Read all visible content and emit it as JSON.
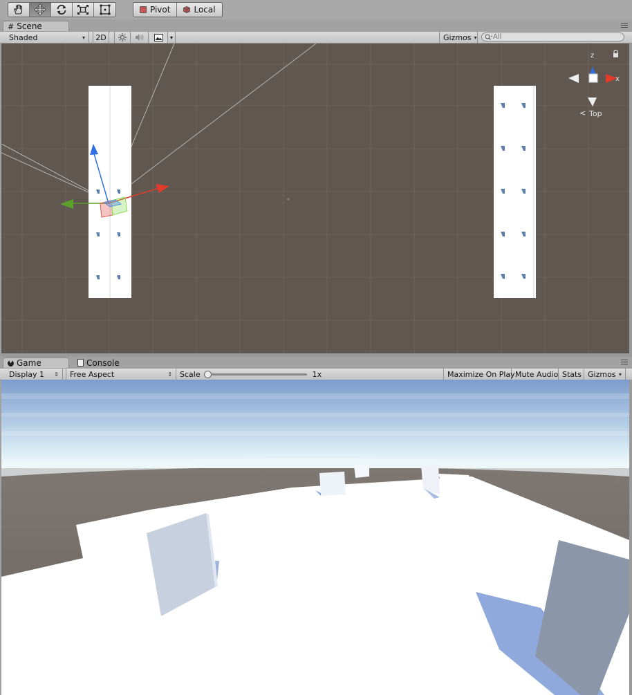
{
  "toolbar": {
    "tools": [
      {
        "name": "hand-tool-icon"
      },
      {
        "name": "move-tool-icon"
      },
      {
        "name": "rotate-tool-icon"
      },
      {
        "name": "scale-tool-icon"
      },
      {
        "name": "rect-tool-icon"
      }
    ],
    "pivot_label": "Pivot",
    "local_label": "Local"
  },
  "scene": {
    "tab_label": "Scene",
    "shading_mode": "Shaded",
    "mode_2d": "2D",
    "gizmos_label": "Gizmos",
    "search_placeholder": "All",
    "orientation_label": "Top",
    "axis_labels": {
      "x": "x",
      "z": "z"
    }
  },
  "game": {
    "tabs": [
      {
        "label": "Game",
        "icon": "pacman-icon"
      },
      {
        "label": "Console",
        "icon": "console-icon"
      }
    ],
    "display": "Display 1",
    "aspect": "Free Aspect",
    "scale_label": "Scale",
    "scale_value": "1x",
    "scale_fraction": 0,
    "maximize_label": "Maximize On Play",
    "mute_label": "Mute Audio",
    "stats_label": "Stats",
    "gizmos_label": "Gizmos"
  },
  "colors": {
    "scene_bg": "#5f5750",
    "x_axis": "#e03a2a",
    "y_axis": "#5aa02a",
    "z_axis": "#2f6fe0",
    "sky_top": "#7d9ccc",
    "horizon": "#e8f4f8",
    "ground": "#6b6560"
  }
}
